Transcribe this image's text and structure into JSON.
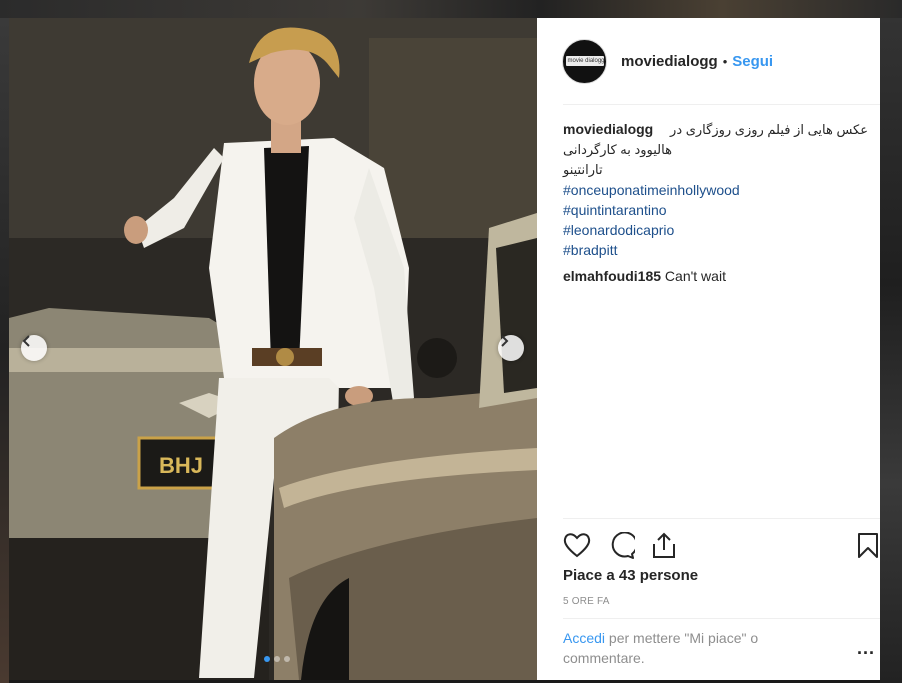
{
  "post": {
    "username": "moviedialogg",
    "separator": "•",
    "follow_label": "Segui",
    "avatar_text": "movie dialogg"
  },
  "caption": {
    "username": "moviedialogg",
    "text_line1": "عکس هایی از فیلم روزی روزگاری در",
    "text_line2": "هالیوود به کارگردانی تارانتینو",
    "hashtags": [
      "#onceuponatimeinhollywood",
      "#quintintarantino",
      "#leonardodicaprio",
      "#bradpitt"
    ]
  },
  "comments": [
    {
      "username": "elmahfoudi185",
      "text": "Can't wait"
    }
  ],
  "likes": "Piace a 43 persone",
  "timestamp": "5 ORE FA",
  "footer": {
    "login_link": "Accedi",
    "login_text": "per mettere \"Mi piace\" o commentare.",
    "more": "..."
  },
  "icons": {
    "like": "heart-icon",
    "comment": "comment-icon",
    "share": "share-icon",
    "save": "bookmark-icon",
    "prev": "chevron-left-icon",
    "next": "chevron-right-icon"
  },
  "carousel": {
    "slides": 3,
    "active_index": 0
  },
  "colors": {
    "accent": "#3897f0",
    "hashtag": "#1d4f8b",
    "muted": "#8e8e8e"
  }
}
